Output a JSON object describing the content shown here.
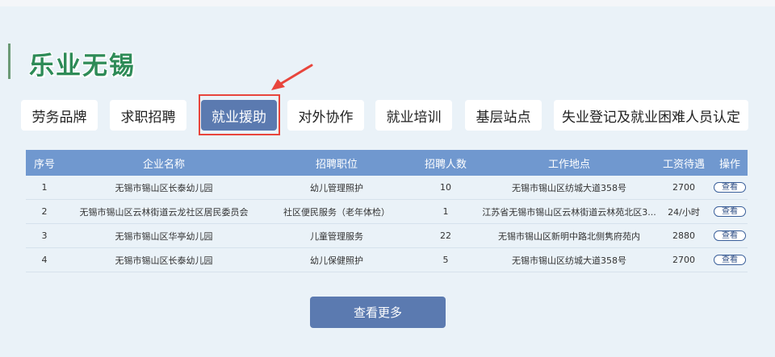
{
  "page": {
    "title": "乐业无锡"
  },
  "tabs": [
    {
      "label": "劳务品牌"
    },
    {
      "label": "求职招聘"
    },
    {
      "label": "就业援助"
    },
    {
      "label": "对外协作"
    },
    {
      "label": "就业培训"
    },
    {
      "label": "基层站点"
    },
    {
      "label": "失业登记及就业困难人员认定"
    }
  ],
  "active_tab": "就业援助",
  "table": {
    "headers": [
      "序号",
      "企业名称",
      "招聘职位",
      "招聘人数",
      "工作地点",
      "工资待遇",
      "操作"
    ],
    "rows": [
      {
        "no": "1",
        "company": "无锡市锡山区长泰幼儿园",
        "position": "幼儿管理照护",
        "count": "10",
        "location": "无锡市锡山区纺城大道358号",
        "salary": "2700",
        "action": "查看"
      },
      {
        "no": "2",
        "company": "无锡市锡山区云林街道云龙社区居民委员会",
        "position": "社区便民服务（老年体检）",
        "count": "1",
        "location": "江苏省无锡市锡山区云林街道云林苑北区3...",
        "salary": "24/小时",
        "action": "查看"
      },
      {
        "no": "3",
        "company": "无锡市锡山区华亭幼儿园",
        "position": "儿童管理服务",
        "count": "22",
        "location": "无锡市锡山区新明中路北侧隽府苑内",
        "salary": "2880",
        "action": "查看"
      },
      {
        "no": "4",
        "company": "无锡市锡山区长泰幼儿园",
        "position": "幼儿保健照护",
        "count": "5",
        "location": "无锡市锡山区纺城大道358号",
        "salary": "2700",
        "action": "查看"
      }
    ]
  },
  "more_button": {
    "label": "查看更多"
  },
  "colors": {
    "accent": "#5b7ab0",
    "header": "#7098cf",
    "title": "#2e8b57",
    "highlight": "#e8453c",
    "background": "#eaf2f8"
  }
}
